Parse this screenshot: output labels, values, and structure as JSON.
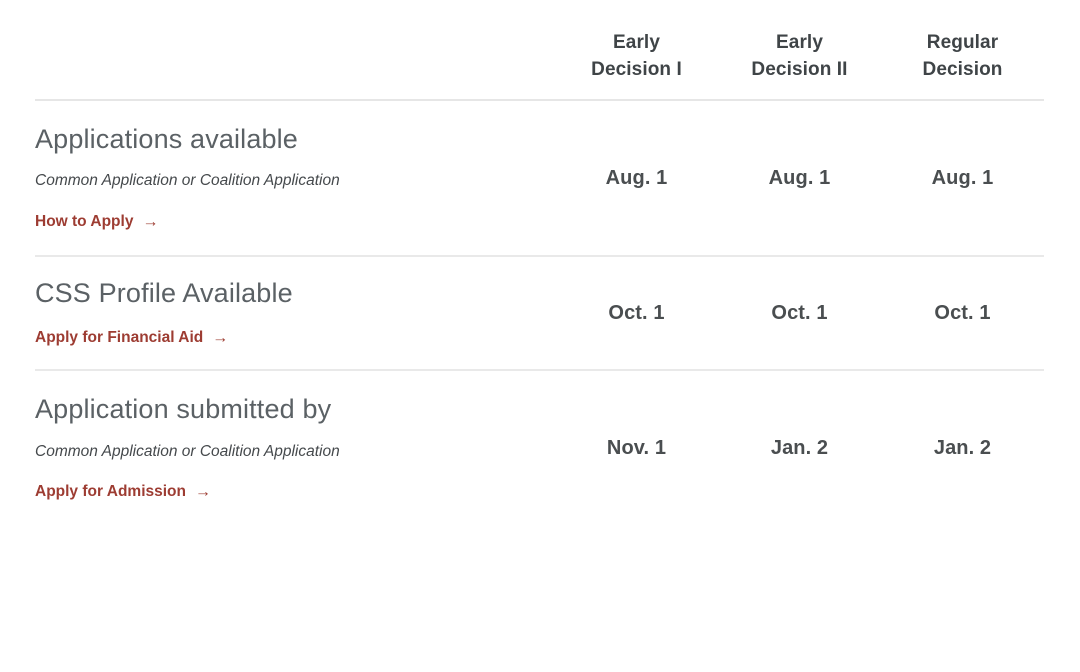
{
  "table": {
    "columns": [
      {
        "line1": "Early",
        "line2": "Decision I"
      },
      {
        "line1": "Early",
        "line2": "Decision II"
      },
      {
        "line1": "Regular",
        "line2": "Decision"
      }
    ],
    "rows": [
      {
        "title": "Applications available",
        "subtitle": "Common Application or Coalition Application",
        "link": "How to Apply",
        "arrow": "→",
        "dates": [
          "Aug. 1",
          "Aug. 1",
          "Aug. 1"
        ]
      },
      {
        "title": "CSS Profile Available",
        "subtitle": "",
        "link": "Apply for Financial Aid",
        "arrow": "→",
        "dates": [
          "Oct. 1",
          "Oct. 1",
          "Oct. 1"
        ]
      },
      {
        "title": "Application submitted by",
        "subtitle": "Common Application or Coalition Application",
        "link": "Apply for Admission",
        "arrow": "→",
        "dates": [
          "Nov. 1",
          "Jan. 2",
          "Jan. 2"
        ]
      }
    ]
  },
  "colors": {
    "link": "#9d3c32",
    "title": "#5b6165",
    "date": "#4a4e50",
    "header": "#3f4447",
    "rule": "#e9e9e9",
    "background": "#ffffff"
  }
}
